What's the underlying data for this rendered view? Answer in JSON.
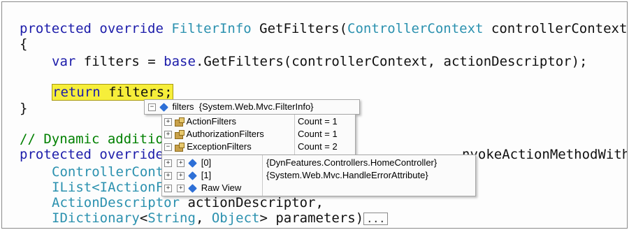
{
  "code": {
    "line1": {
      "kw": "protected override ",
      "type1": "FilterInfo",
      "mid": " GetFilters(",
      "type2": "ControllerContext",
      "rest": " controllerContext,"
    },
    "line2": "{",
    "line3": {
      "kw": "var",
      "rest": " filters = ",
      "kw2": "base",
      "rest2": ".GetFilters(controllerContext, actionDescriptor);"
    },
    "line4": {
      "kw": "return",
      "space": " ",
      "hl": "filters",
      "semi": ";"
    },
    "line5": "}",
    "line6": "// Dynamic additio",
    "line7": {
      "kw": "protected override",
      "tail": "nvokeActionMethodWithFilters("
    },
    "line8": {
      "type": "ControllerCont"
    },
    "line9": {
      "type": "IList<IActionFi"
    },
    "line10": {
      "type": "ActionDescriptor",
      "rest": " actionDescriptor,"
    },
    "line11": {
      "type": "IDictionary",
      "lt": "<",
      "type2": "String",
      "comma": ", ",
      "type3": "Object",
      "rest": "> parameters)",
      "ellipsis": "..."
    }
  },
  "datatip": {
    "root": {
      "name": "filters",
      "value": "{System.Web.Mvc.FilterInfo}",
      "icon": "field-icon",
      "toggle": "minus"
    },
    "members": [
      {
        "name": "ActionFilters",
        "value": "Count = 1",
        "icon": "property-icon",
        "toggle": "plus"
      },
      {
        "name": "AuthorizationFilters",
        "value": "Count = 1",
        "icon": "property-icon",
        "toggle": "plus"
      },
      {
        "name": "ExceptionFilters",
        "value": "Count = 2",
        "icon": "property-icon",
        "toggle": "minus"
      }
    ],
    "items": [
      {
        "name": "[0]",
        "value": "{DynFeatures.Controllers.HomeController}",
        "icon": "field-icon",
        "toggle": "plus"
      },
      {
        "name": "[1]",
        "value": "{System.Web.Mvc.HandleErrorAttribute}",
        "icon": "field-icon",
        "toggle": "plus"
      },
      {
        "name": "Raw View",
        "value": "",
        "icon": "field-icon",
        "toggle": "plus"
      }
    ]
  }
}
